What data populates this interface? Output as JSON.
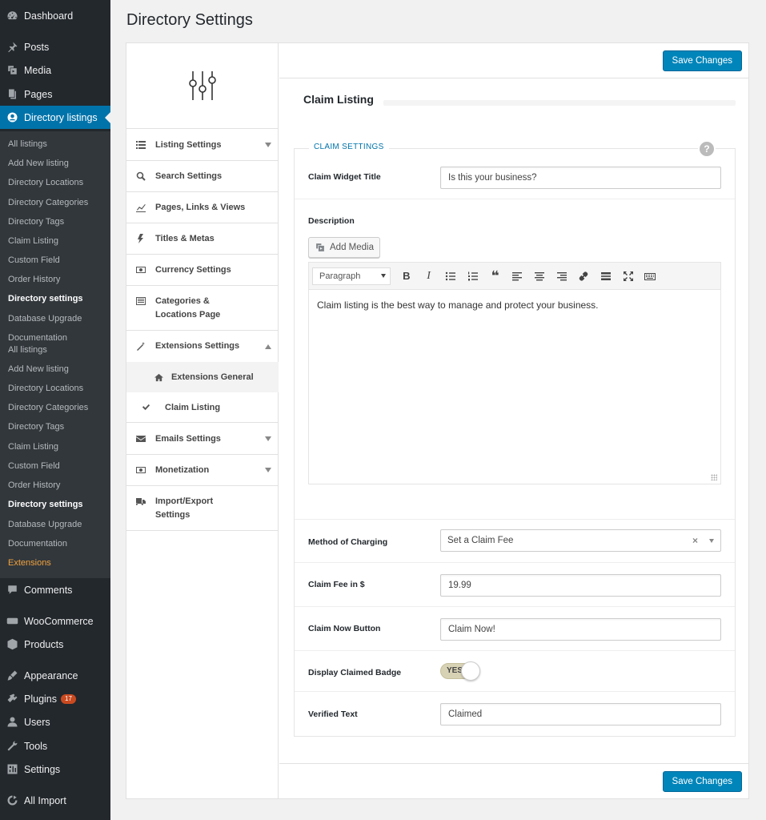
{
  "page_title": "Directory Settings",
  "admin_menu": {
    "top": [
      {
        "label": "Dashboard",
        "icon": "dashboard-icon"
      },
      {
        "label": "Posts",
        "icon": "pin-icon"
      },
      {
        "label": "Media",
        "icon": "media-icon"
      },
      {
        "label": "Pages",
        "icon": "pages-icon"
      },
      {
        "label": "Directory listings",
        "icon": "directory-icon"
      }
    ],
    "submenu": [
      "All listings",
      "Add New listing",
      "Directory Locations",
      "Directory Categories",
      "Directory Tags",
      "Claim Listing",
      "Custom Field",
      "Order History",
      "Directory settings",
      "Database Upgrade",
      "Documentation",
      "All listings",
      "Add New listing",
      "Directory Locations",
      "Directory Categories",
      "Directory Tags",
      "Claim Listing",
      "Custom Field",
      "Order History",
      "Directory settings",
      "Database Upgrade",
      "Documentation",
      "Extensions"
    ],
    "bottom": [
      {
        "label": "Comments",
        "icon": "comments-icon"
      },
      {
        "label": "WooCommerce",
        "icon": "woocommerce-icon"
      },
      {
        "label": "Products",
        "icon": "products-icon"
      },
      {
        "label": "Appearance",
        "icon": "appearance-icon"
      },
      {
        "label": "Plugins",
        "icon": "plugins-icon",
        "badge": "17"
      },
      {
        "label": "Users",
        "icon": "users-icon"
      },
      {
        "label": "Tools",
        "icon": "tools-icon"
      },
      {
        "label": "Settings",
        "icon": "settings-icon"
      },
      {
        "label": "All Import",
        "icon": "import-icon"
      }
    ]
  },
  "settings_nav": {
    "items": [
      {
        "label": "Listing Settings",
        "icon": "list-icon"
      },
      {
        "label": "Search Settings",
        "icon": "search-icon"
      },
      {
        "label": "Pages, Links & Views",
        "icon": "chart-icon"
      },
      {
        "label": "Titles & Metas",
        "icon": "bolt-icon"
      },
      {
        "label": "Currency Settings",
        "icon": "money-icon"
      },
      {
        "label": "Categories &",
        "label2": "Locations Page",
        "icon": "list-alt-icon"
      },
      {
        "label": "Extensions Settings",
        "icon": "wand-icon"
      },
      {
        "label": "Emails Settings",
        "icon": "envelope-icon"
      },
      {
        "label": "Monetization",
        "icon": "money-icon"
      },
      {
        "label": "Import/Export",
        "label2": "Settings",
        "icon": "truck-icon"
      }
    ],
    "sub": [
      {
        "label": "Extensions General",
        "icon": "home-icon"
      },
      {
        "label": "Claim Listing",
        "icon": "check-icon"
      }
    ]
  },
  "main": {
    "save_label": "Save Changes",
    "section_title": "Claim Listing",
    "legend": "CLAIM SETTINGS",
    "help": "?",
    "fields": {
      "widget_title": {
        "label": "Claim Widget Title",
        "value": "Is this your business?"
      },
      "description": {
        "label": "Description",
        "add_media": "Add Media",
        "format": "Paragraph",
        "content": "Claim listing is the best way to manage and protect your business."
      },
      "method": {
        "label": "Method of Charging",
        "value": "Set a Claim Fee",
        "clear": "×"
      },
      "fee": {
        "label": "Claim Fee in $",
        "value": "19.99"
      },
      "button": {
        "label": "Claim Now Button",
        "value": "Claim Now!"
      },
      "badge": {
        "label": "Display Claimed Badge",
        "toggle_text": "YES",
        "enabled": true
      },
      "verified": {
        "label": "Verified Text",
        "value": "Claimed"
      }
    },
    "toolbar_bold": "B",
    "toolbar_italic": "I",
    "toolbar_quote": "❝"
  }
}
